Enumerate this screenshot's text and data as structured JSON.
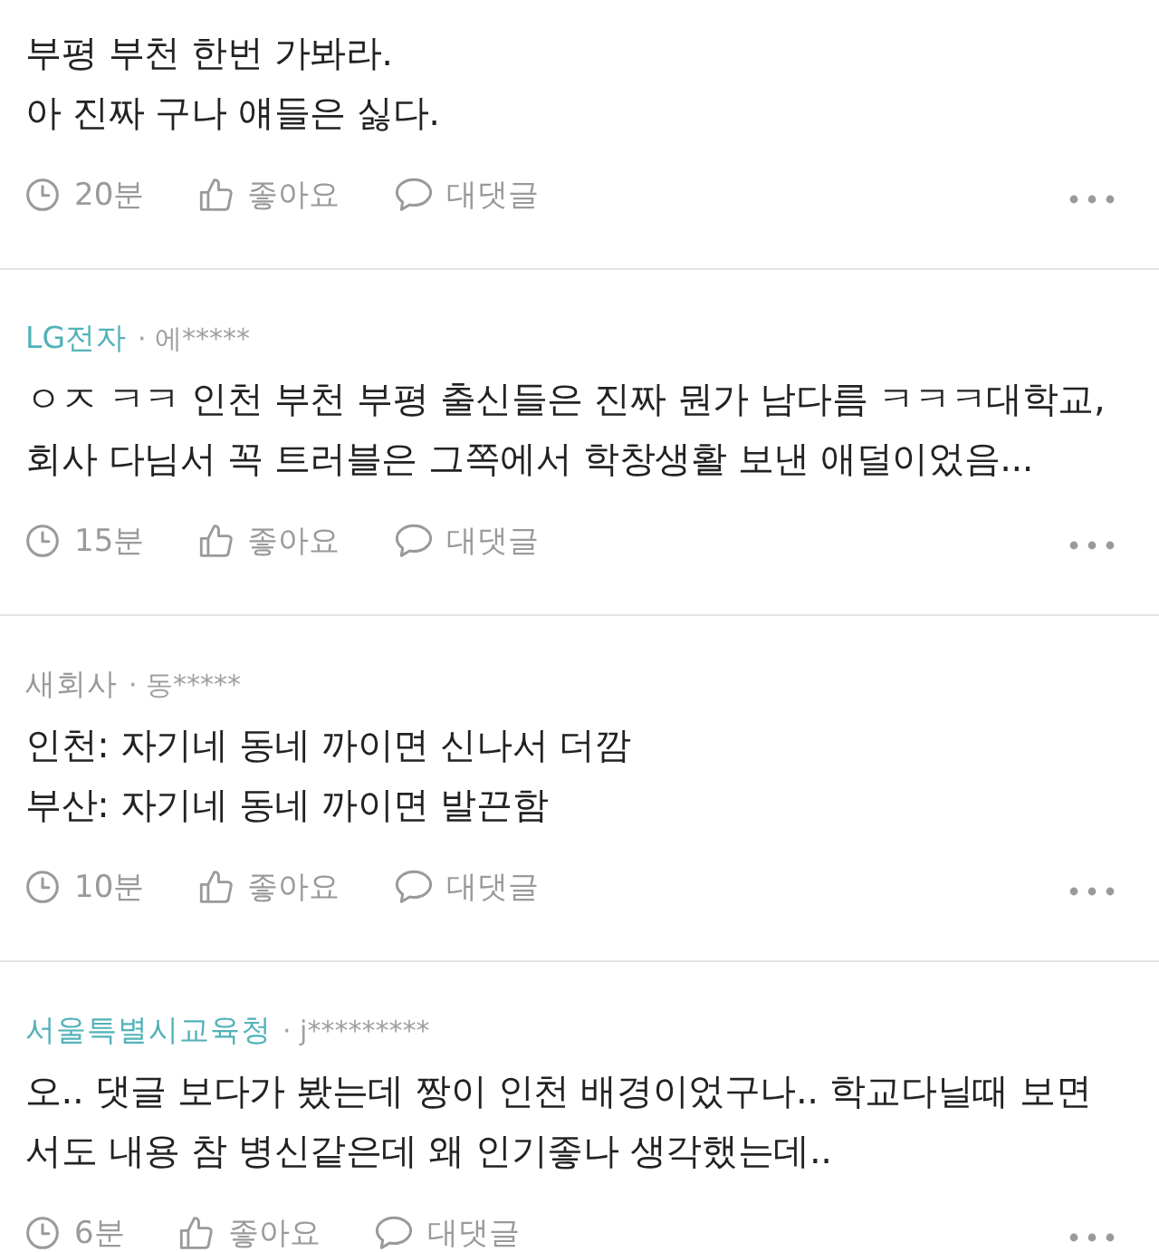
{
  "comments": [
    {
      "text": "부평 부천 한번 가봐라.\n아 진짜 구나 얘들은 싫다.",
      "time": "20분",
      "like": "좋아요",
      "reply": "대댓글"
    },
    {
      "company": "LG전자",
      "color": "#52b2b8",
      "user": "· 에*****",
      "text": "ㅇㅈ ㅋㅋ 인천 부천 부평 출신들은 진짜 뭔가 남다름 ㅋㅋㅋ대학교,\n회사 다님서 꼭 트러블은 그쪽에서 학창생활 보낸 애덜이었음...",
      "time": "15분",
      "like": "좋아요",
      "reply": "대댓글"
    },
    {
      "company": "새회사",
      "color": "#999999",
      "user": "· 동*****",
      "text": "인천: 자기네 동네 까이면 신나서 더깜\n부산: 자기네 동네 까이면 발끈함",
      "time": "10분",
      "like": "좋아요",
      "reply": "대댓글"
    },
    {
      "company": "서울특별시교육청",
      "color": "#52b2b8",
      "user": "· j*********",
      "text": "오.. 댓글 보다가 봤는데 짱이 인천 배경이었구나.. 학교다닐때 보면\n서도 내용 참 병신같은데 왜 인기좋나 생각했는데..",
      "time": "6분",
      "like": "좋아요",
      "reply": "대댓글"
    }
  ]
}
